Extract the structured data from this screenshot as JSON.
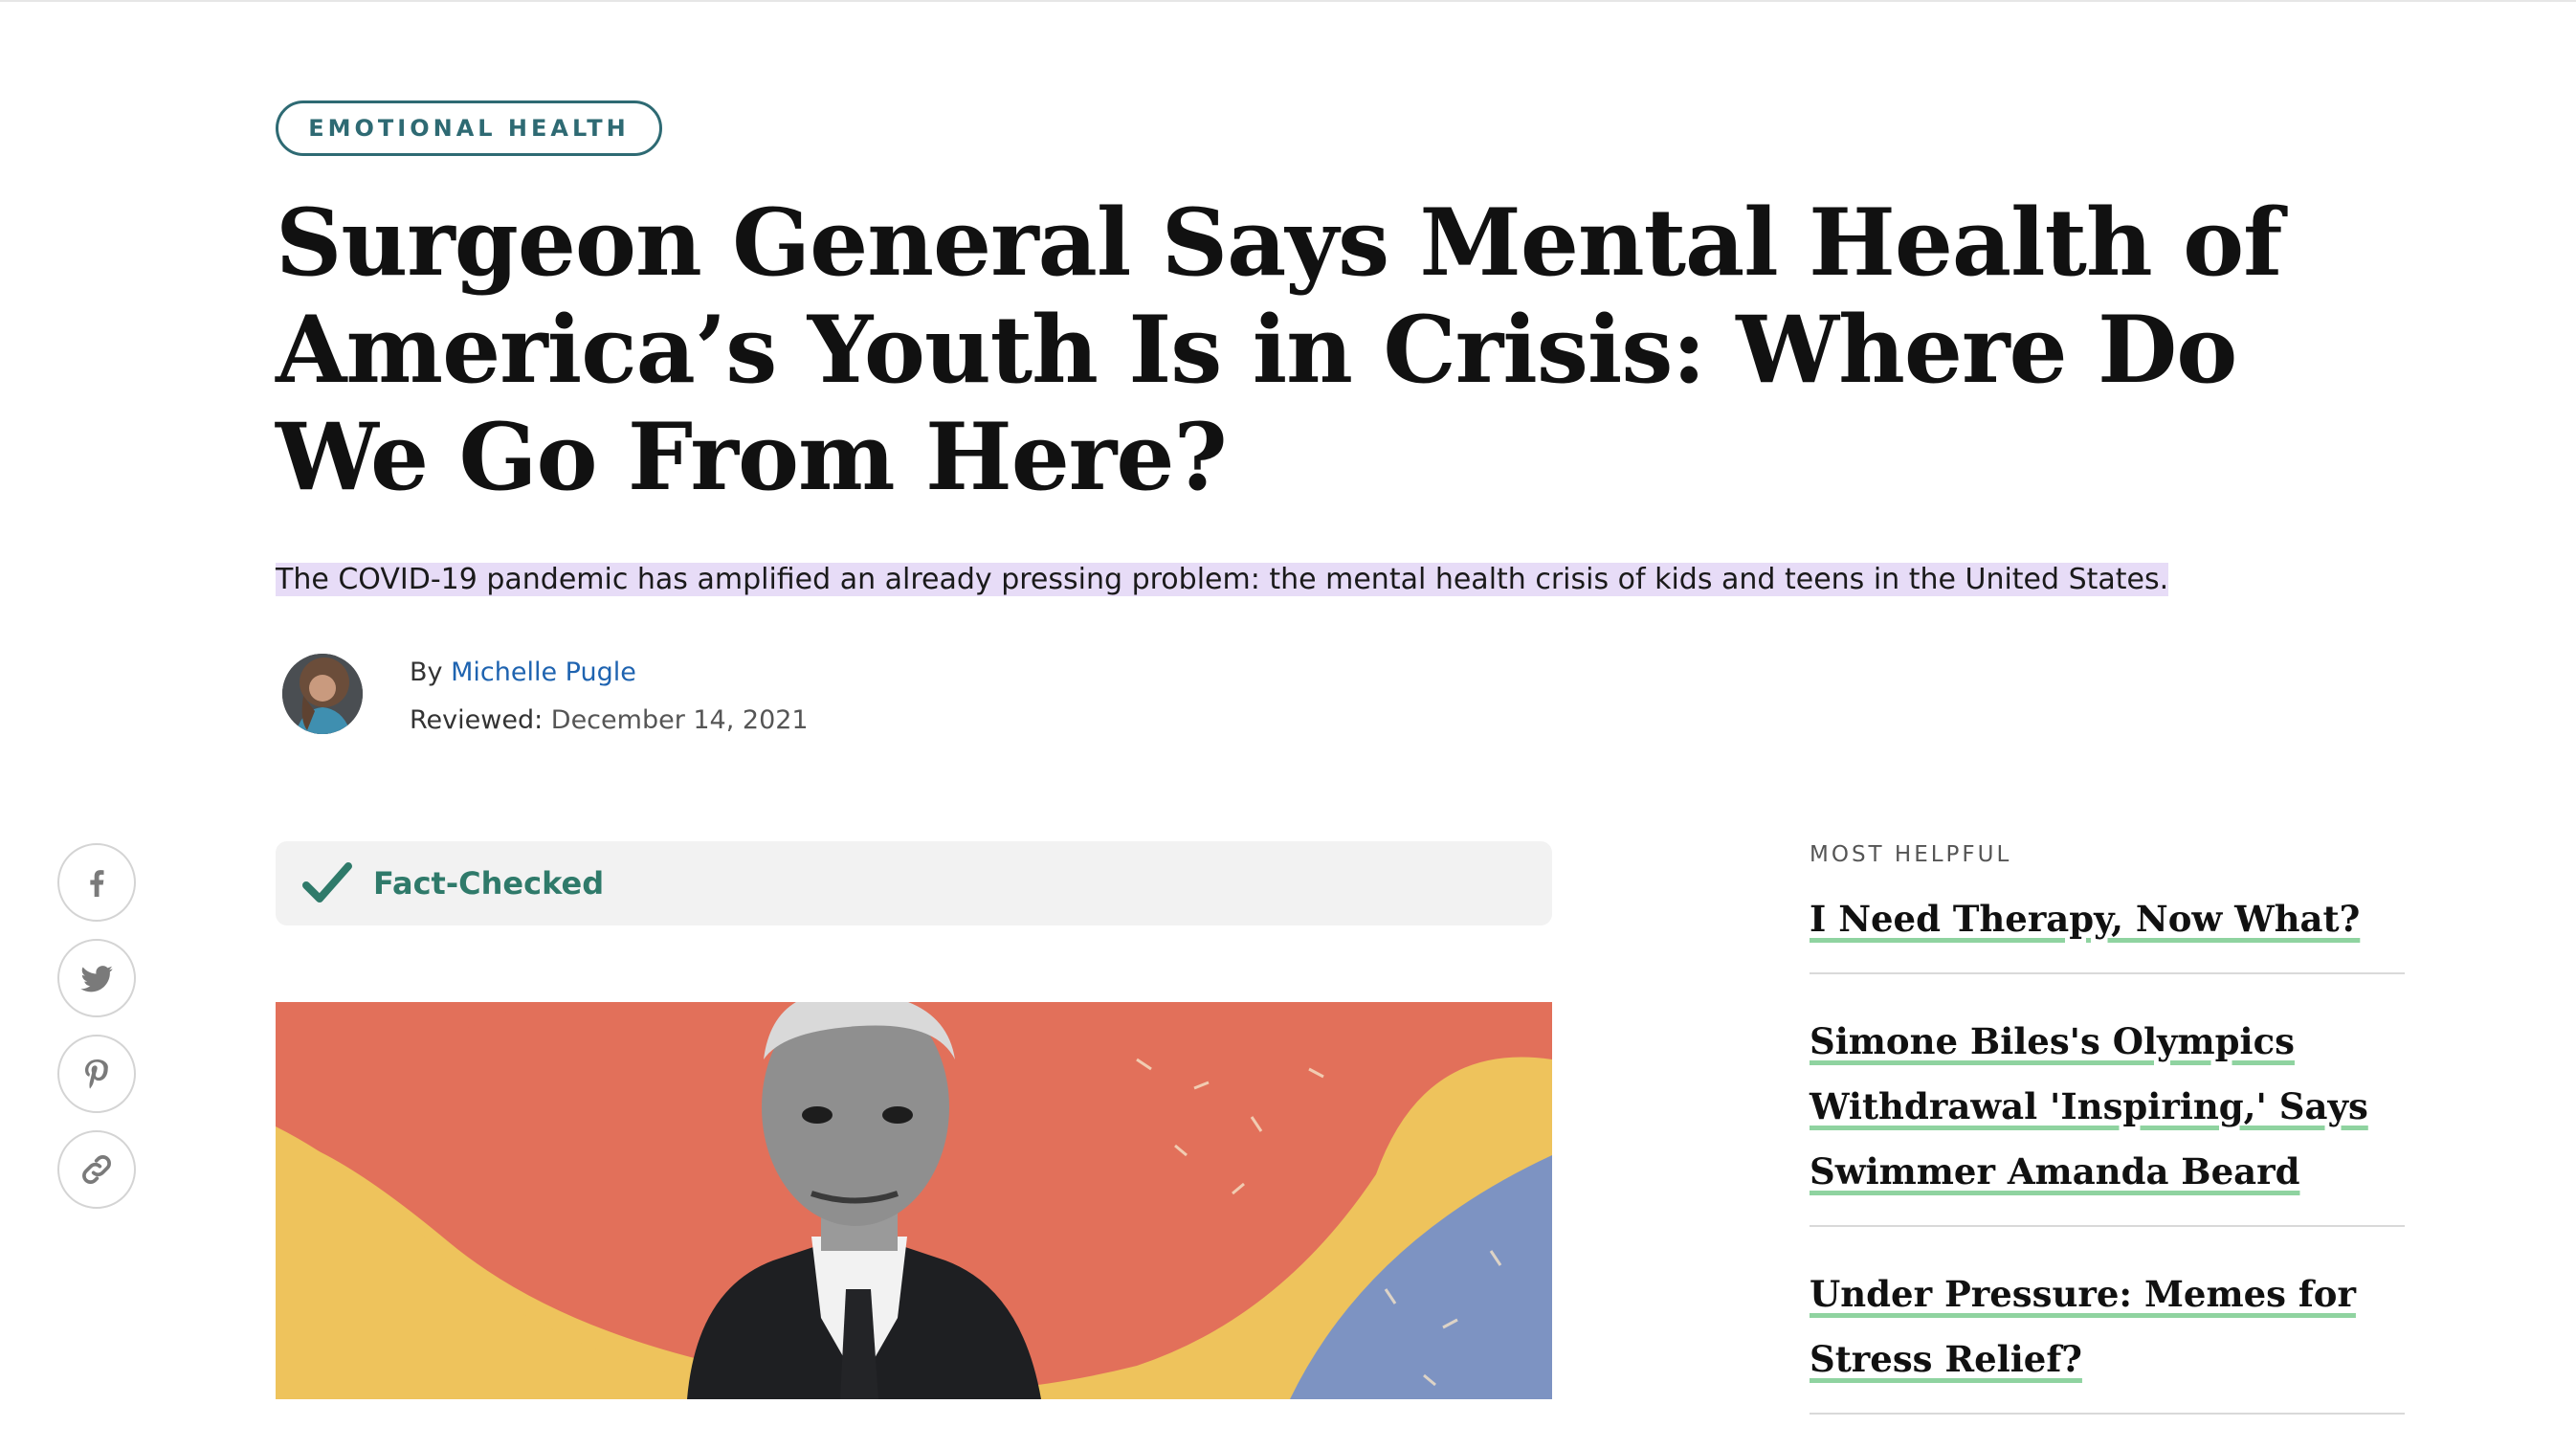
{
  "article": {
    "category": "EMOTIONAL HEALTH",
    "title": "Surgeon General Says Mental Health of America’s Youth Is in Crisis: Where Do We Go From Here?",
    "subtitle": "The COVID-19 pandemic has amplified an already pressing problem: the mental health crisis of kids and teens in the United States.",
    "byline": {
      "by_label": "By",
      "author": "Michelle Pugle",
      "reviewed_label": "Reviewed:",
      "reviewed_date": "December 14, 2021"
    },
    "fact_check_label": "Fact-Checked"
  },
  "share": {
    "icons": [
      "facebook-icon",
      "twitter-icon",
      "pinterest-icon",
      "link-icon"
    ]
  },
  "sidebar": {
    "heading": "MOST HELPFUL",
    "items": [
      {
        "title": "I Need Therapy, Now What?"
      },
      {
        "title": "Simone Biles's Olympics Withdrawal 'Inspiring,' Says Swimmer Amanda Beard"
      },
      {
        "title": "Under Pressure: Memes for Stress Relief?"
      }
    ]
  },
  "colors": {
    "accent_teal": "#2e6a73",
    "fact_green": "#2f7a6a",
    "link_blue": "#1e63b0",
    "highlight_purple": "#e7dcf7",
    "underline_green": "#8fd3a0",
    "hero_coral": "#e2705a",
    "hero_yellow": "#eec35c",
    "hero_blue": "#7d93c2"
  }
}
